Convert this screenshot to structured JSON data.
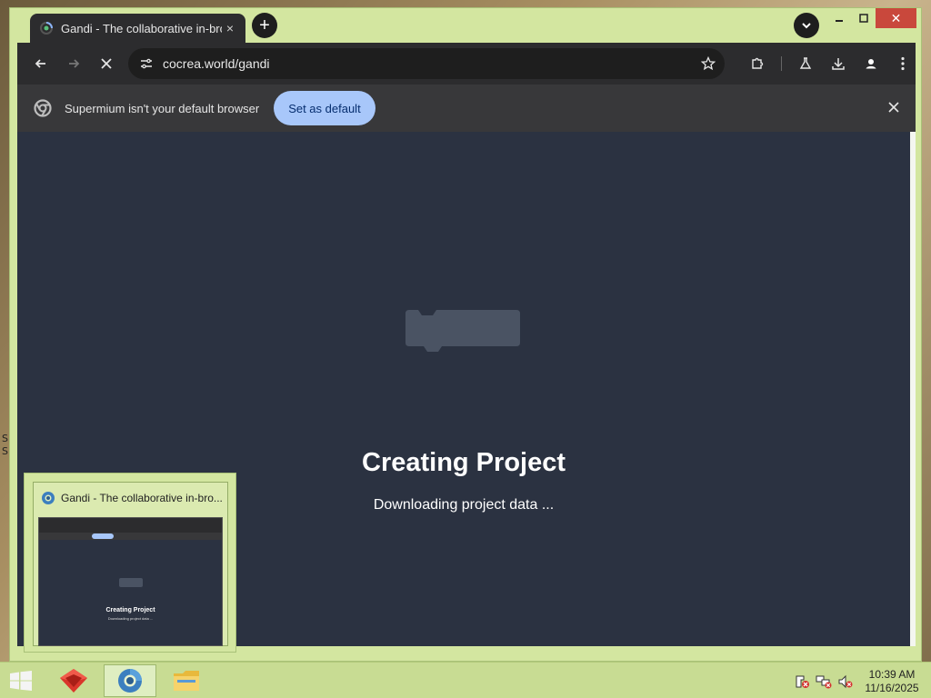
{
  "browser": {
    "tab": {
      "title": "Gandi - The collaborative in-bro",
      "close_glyph": "×"
    },
    "new_tab_glyph": "+",
    "window_close_glyph": "✕",
    "address": {
      "url": "cocrea.world/gandi"
    },
    "infobar": {
      "message": "Supermium isn't your default browser",
      "button_label": "Set as default",
      "close_glyph": "✕"
    }
  },
  "page": {
    "heading": "Creating Project",
    "status": "Downloading project data ..."
  },
  "preview": {
    "title": "Gandi - The collaborative in-bro...",
    "heading": "Creating Project",
    "status": "Downloading project data ..."
  },
  "clock": {
    "time": "10:39 AM",
    "date": "11/16/2025"
  },
  "desktop_fragments": {
    "left_edge_1": "S",
    "left_edge_2": "S"
  },
  "colors": {
    "window_frame": "#d3e6a0",
    "toolbar": "#2c2c2e",
    "infobar": "#38383a",
    "content_bg": "#2b3241",
    "accent_button": "#a8c7fa",
    "close_button": "#c9483c"
  }
}
